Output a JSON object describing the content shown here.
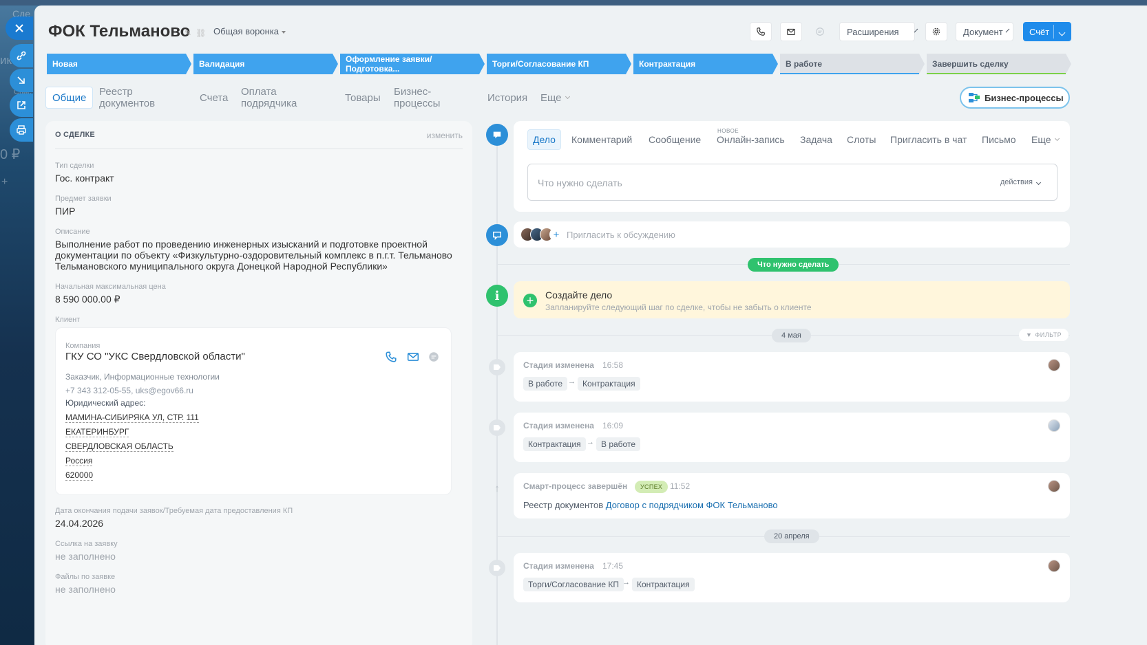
{
  "background": {
    "ghost_texts": [
      "Сде",
      "ик",
      "Спис",
      "0 ₽",
      "+"
    ]
  },
  "header": {
    "title": "ФОК Тельманово",
    "funnel": "Общая воронка",
    "extensions_label": "Расширения",
    "document_label": "Документ",
    "invoice_label": "Счёт"
  },
  "stages": [
    {
      "label": "Новая",
      "state": "active"
    },
    {
      "label": "Валидация",
      "state": "active"
    },
    {
      "label": "Оформление заявки/Подготовка...",
      "state": "active"
    },
    {
      "label": "Торги/Согласование КП",
      "state": "active"
    },
    {
      "label": "Контрактация",
      "state": "active"
    },
    {
      "label": "В работе",
      "state": "inactive",
      "underline": "#3fa3ee"
    },
    {
      "label": "Завершить сделку",
      "state": "inactive",
      "underline": "#7bd148"
    }
  ],
  "tabs": [
    "Общие",
    "Реестр документов",
    "Счета",
    "Оплата подрядчика",
    "Товары",
    "Бизнес-процессы",
    "История",
    "Еще"
  ],
  "bp_button": "Бизнес-процессы",
  "deal": {
    "section_title": "О СДЕЛКЕ",
    "edit_label": "изменить",
    "fields": {
      "type_label": "Тип сделки",
      "type_value": "Гос. контракт",
      "subject_label": "Предмет заявки",
      "subject_value": "ПИР",
      "desc_label": "Описание",
      "desc_value": "Выполнение работ по проведению инженерных изысканий и подготовке проектной документации по объекту «Физкультурно-оздоровительный комплекс в п.г.т. Тельманово Тельмановского муниципального округа Донецкой Народной Республики»",
      "price_label": "Начальная максимальная цена",
      "price_value": "8 590 000.00 ₽",
      "client_label": "Клиент",
      "deadline_label": "Дата окончания подачи заявок/Требуемая дата предоставления КП",
      "deadline_value": "24.04.2026",
      "link_label": "Ссылка на заявку",
      "link_value": "не заполнено",
      "files_label": "Файлы по заявке",
      "files_value": "не заполнено"
    },
    "client": {
      "company_label": "Компания",
      "name": "ГКУ СО \"УКС Свердловской области\"",
      "tags": "Заказчик, Информационные технологии",
      "contacts": "+7 343 312-05-55, uks@egov66.ru",
      "address_label": "Юридический адрес:",
      "address": [
        "МАМИНА-СИБИРЯКА УЛ, СТР. 111",
        "ЕКАТЕРИНБУРГ",
        "СВЕРДЛОВСКАЯ ОБЛАСТЬ",
        "Россия",
        "620000"
      ]
    }
  },
  "composer": {
    "tabs": [
      "Дело",
      "Комментарий",
      "Сообщение",
      "Онлайн-запись",
      "Задача",
      "Слоты",
      "Пригласить в чат",
      "Письмо",
      "Еще"
    ],
    "new_badge": "НОВОЕ",
    "placeholder": "Что нужно сделать",
    "actions": "действия"
  },
  "invite_placeholder": "Пригласить к обсуждению",
  "todo_pill": "Что нужно сделать",
  "todo": {
    "title": "Создайте дело",
    "subtitle": "Запланируйте следующий шаг по сделке, чтобы не забыть о клиенте"
  },
  "filter_label": "ФИЛЬТР",
  "dates": [
    "4 мая",
    "20 апреля"
  ],
  "events": [
    {
      "title": "Стадия изменена",
      "time": "16:58",
      "from": "В работе",
      "to": "Контрактация"
    },
    {
      "title": "Стадия изменена",
      "time": "16:09",
      "from": "Контрактация",
      "to": "В работе"
    },
    {
      "title": "Смарт-процесс завершён",
      "badge": "УСПЕХ",
      "time": "11:52",
      "text": "Реестр документов",
      "link": "Договор с подрядчиком ФОК Тельманово"
    },
    {
      "title": "Стадия изменена",
      "time": "17:45",
      "from": "Торги/Согласование КП",
      "to": "Контрактация"
    }
  ],
  "colors": {
    "accent": "#2c8fd8",
    "stage_active": "#3fa3ee",
    "success": "#2fc26e",
    "todo_bg": "#fff6dc"
  }
}
